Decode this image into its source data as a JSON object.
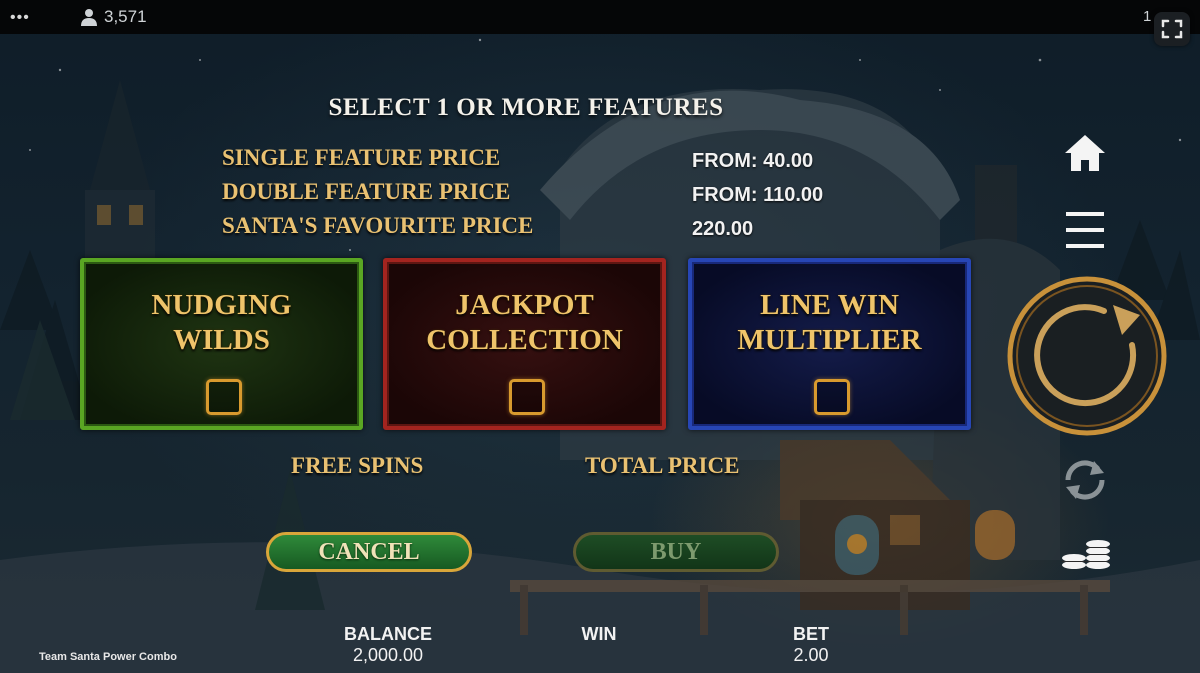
{
  "topbar": {
    "menu_dots": "•••",
    "player_count": "3,571",
    "clock_partial": "1"
  },
  "panel": {
    "heading": "SELECT 1 OR MORE FEATURES",
    "prices": [
      {
        "label": "SINGLE FEATURE PRICE",
        "value": "FROM: 40.00"
      },
      {
        "label": "DOUBLE FEATURE PRICE",
        "value": "FROM: 110.00"
      },
      {
        "label": "SANTA'S FAVOURITE PRICE",
        "value": "220.00"
      }
    ],
    "features": [
      {
        "line1": "NUDGING",
        "line2": "WILDS",
        "checked": false,
        "border_color": "#5aa623"
      },
      {
        "line1": "JACKPOT",
        "line2": "COLLECTION",
        "checked": false,
        "border_color": "#a3241f"
      },
      {
        "line1": "LINE WIN",
        "line2": "MULTIPLIER",
        "checked": false,
        "border_color": "#2746b5"
      }
    ],
    "free_spins_label": "FREE SPINS",
    "total_price_label": "TOTAL PRICE",
    "cancel_label": "CANCEL",
    "buy_label": "BUY"
  },
  "side_controls": {
    "icons": [
      "home-icon",
      "hamburger-menu-icon",
      "spin-icon",
      "autoplay-icon",
      "coin-stack-icon"
    ]
  },
  "footer": {
    "game_name": "Team Santa Power Combo",
    "balance_label": "BALANCE",
    "balance_value": "2,000.00",
    "win_label": "WIN",
    "bet_label": "BET",
    "bet_value": "2.00"
  },
  "colors": {
    "gold_text": "#e9c172",
    "card_title": "#efc46a",
    "checkbox_border": "#d89a2e"
  }
}
